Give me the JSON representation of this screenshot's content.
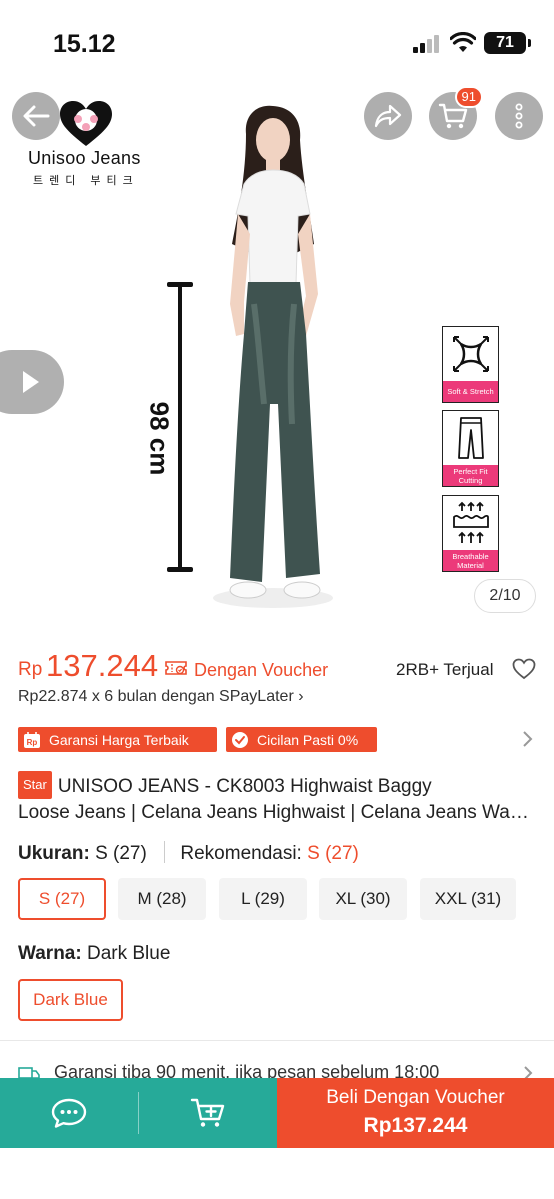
{
  "status_bar": {
    "time": "15.12",
    "battery": "71"
  },
  "header": {
    "cart_count": "91"
  },
  "logo": {
    "brand": "Unisoo Jeans",
    "korean": "트렌디 부티크"
  },
  "gallery": {
    "measure_label": "98 cm",
    "features": [
      {
        "icon": "soft-stretch-icon",
        "label": "Soft & Stretch"
      },
      {
        "icon": "perfect-fit-icon",
        "label": "Perfect Fit Cutting"
      },
      {
        "icon": "breathable-icon",
        "label": "Breathable Material"
      }
    ],
    "counter": "2/10"
  },
  "price": {
    "currency": "Rp",
    "amount": "137.244",
    "voucher_text": "Dengan Voucher",
    "sold": "2RB+ Terjual",
    "installment": "Rp22.874 x 6 bulan dengan SPayLater ›"
  },
  "badges": [
    {
      "icon": "price-guarantee-icon",
      "label": "Garansi Harga Terbaik"
    },
    {
      "icon": "check-circle-icon",
      "label": "Cicilan Pasti 0%"
    }
  ],
  "product": {
    "star_label": "Star",
    "title_line1": "UNISOO JEANS - CK8003 Highwaist Baggy",
    "title_line2": "Loose Jeans | Celana Jeans Highwaist | Celana Jeans Wanita"
  },
  "size": {
    "label": "Ukuran:",
    "value": "S (27)",
    "rec_label": "Rekomendasi:",
    "rec_value": "S (27)",
    "options": [
      "S (27)",
      "M (28)",
      "L (29)",
      "XL (30)",
      "XXL (31)"
    ],
    "selected": "S (27)"
  },
  "color": {
    "label": "Warna:",
    "value": "Dark Blue",
    "options": [
      "Dark Blue"
    ]
  },
  "guarantee": {
    "text": "Garansi tiba 90 menit, jika pesan sebelum 18:00"
  },
  "bottom": {
    "buy_line1": "Beli Dengan Voucher",
    "buy_line2": "Rp137.244"
  },
  "colors": {
    "accent": "#ee4d2d",
    "chat": "#26aa99",
    "feature_pink": "#ec3a7a"
  }
}
